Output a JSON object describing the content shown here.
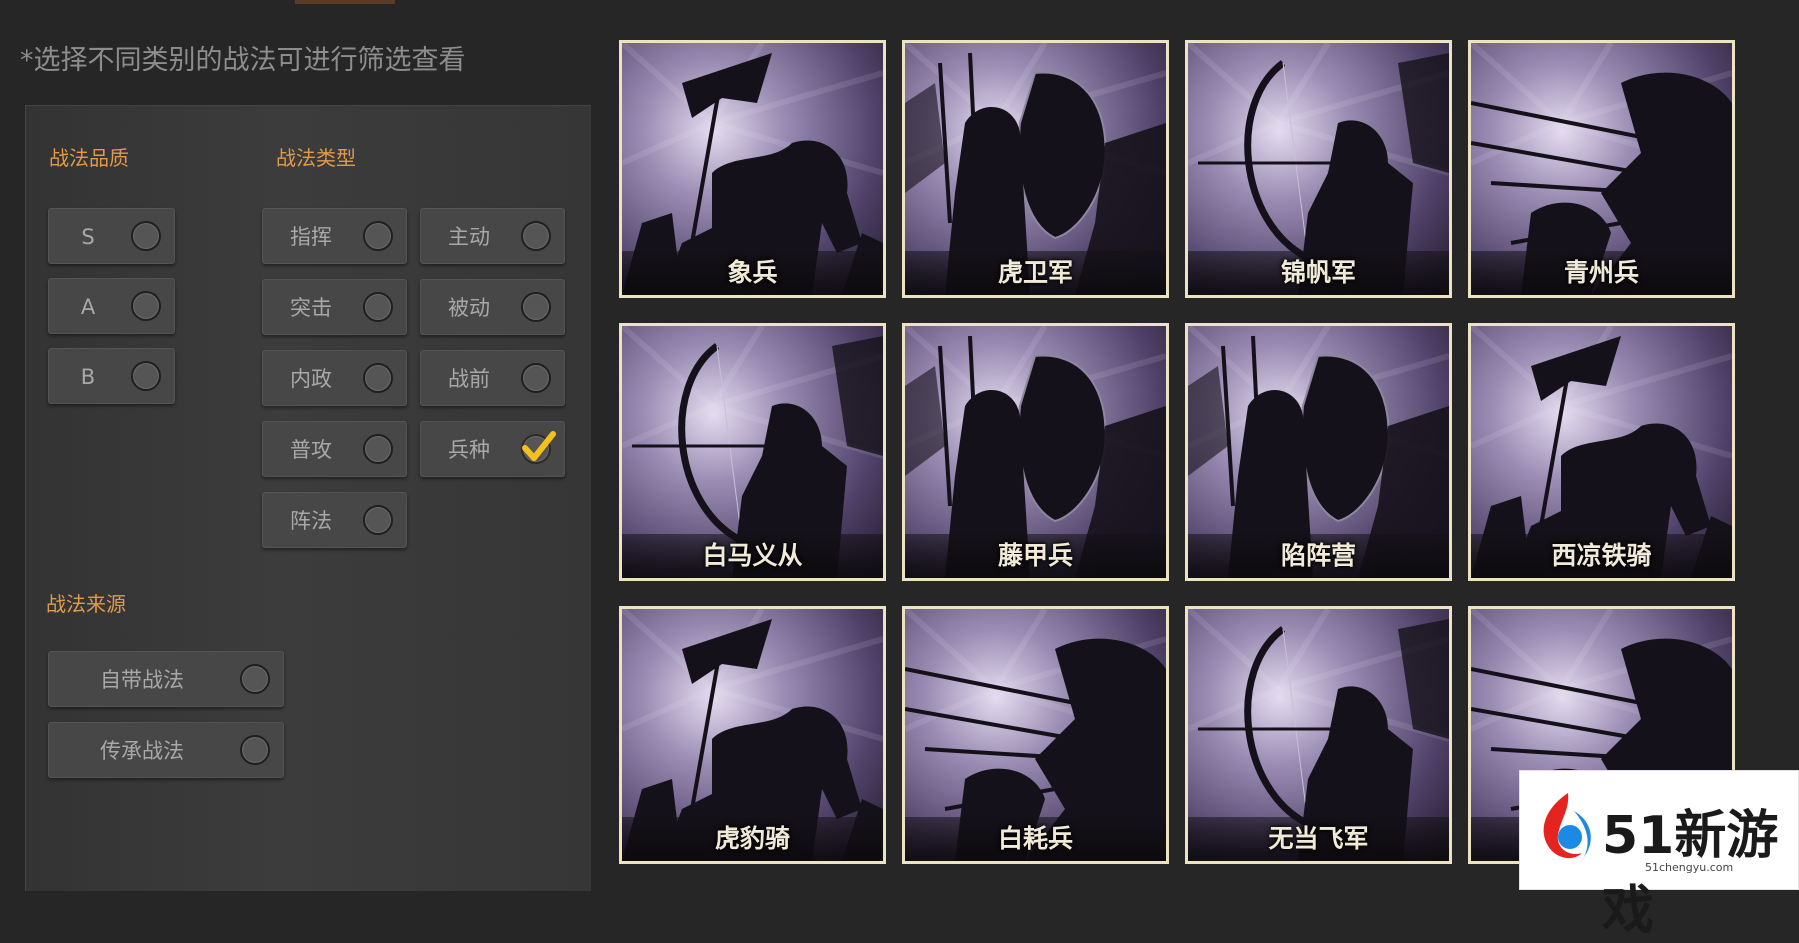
{
  "hint": "*选择不同类别的战法可进行筛选查看",
  "filters": {
    "quality": {
      "title": "战法品质",
      "options": [
        {
          "label": "S",
          "checked": false
        },
        {
          "label": "A",
          "checked": false
        },
        {
          "label": "B",
          "checked": false
        }
      ]
    },
    "type": {
      "title": "战法类型",
      "options": [
        {
          "label": "指挥",
          "checked": false
        },
        {
          "label": "主动",
          "checked": false
        },
        {
          "label": "突击",
          "checked": false
        },
        {
          "label": "被动",
          "checked": false
        },
        {
          "label": "内政",
          "checked": false
        },
        {
          "label": "战前",
          "checked": false
        },
        {
          "label": "普攻",
          "checked": false
        },
        {
          "label": "兵种",
          "checked": true
        },
        {
          "label": "阵法",
          "checked": false
        }
      ]
    },
    "source": {
      "title": "战法来源",
      "options": [
        {
          "label": "自带战法",
          "checked": false
        },
        {
          "label": "传承战法",
          "checked": false
        }
      ]
    }
  },
  "cards": [
    {
      "name": "象兵",
      "art": "flag-cavalry"
    },
    {
      "name": "虎卫军",
      "art": "shield-infantry"
    },
    {
      "name": "锦帆军",
      "art": "archer"
    },
    {
      "name": "青州兵",
      "art": "spear-charge"
    },
    {
      "name": "白马义从",
      "art": "archer"
    },
    {
      "name": "藤甲兵",
      "art": "shield-infantry"
    },
    {
      "name": "陷阵营",
      "art": "shield-infantry"
    },
    {
      "name": "西凉铁骑",
      "art": "flag-cavalry"
    },
    {
      "name": "虎豹骑",
      "art": "flag-cavalry"
    },
    {
      "name": "白耗兵",
      "art": "spear-charge"
    },
    {
      "name": "无当飞军",
      "art": "archer"
    },
    {
      "name": "",
      "art": "spear-charge"
    }
  ],
  "watermark": {
    "text": "51新游戏",
    "url": "51chengyu.com"
  },
  "colors": {
    "background": "#262626",
    "section_title": "#e29a4a",
    "check": "#f2c21b",
    "card_border": "#ece3c2"
  }
}
